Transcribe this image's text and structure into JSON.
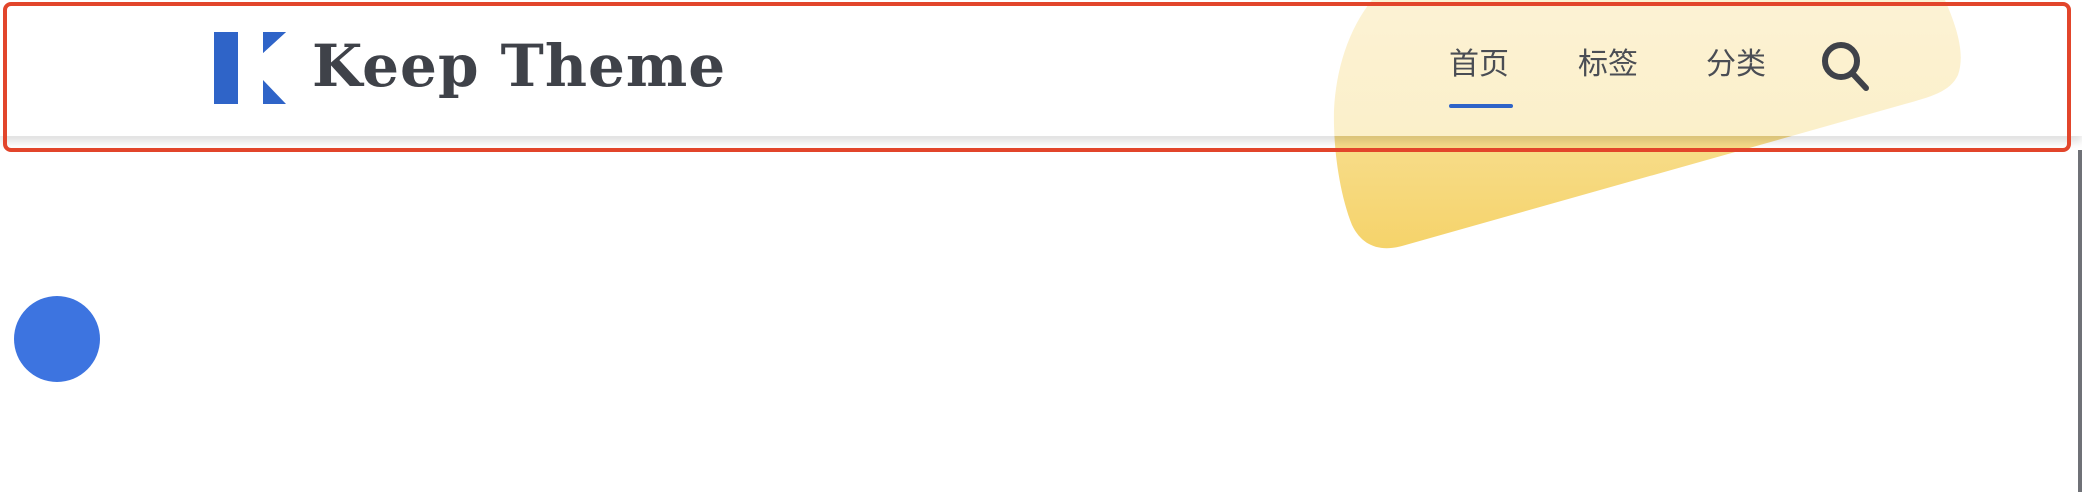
{
  "site": {
    "title": "Keep Theme"
  },
  "nav": {
    "items": [
      {
        "label": "首页",
        "active": true
      },
      {
        "label": "标签",
        "active": false
      },
      {
        "label": "分类",
        "active": false
      }
    ],
    "search_icon": "search-icon"
  },
  "icons": {
    "logo": "keep-k-logo",
    "search": "search-icon",
    "floating_button": "circle-button"
  },
  "colors": {
    "brand_blue": "#2f64c8",
    "title_gray": "#3f4249",
    "blob_yellow": "#f6d77a",
    "highlight_red": "#e2452b",
    "float_button_blue": "#3d74e0"
  }
}
